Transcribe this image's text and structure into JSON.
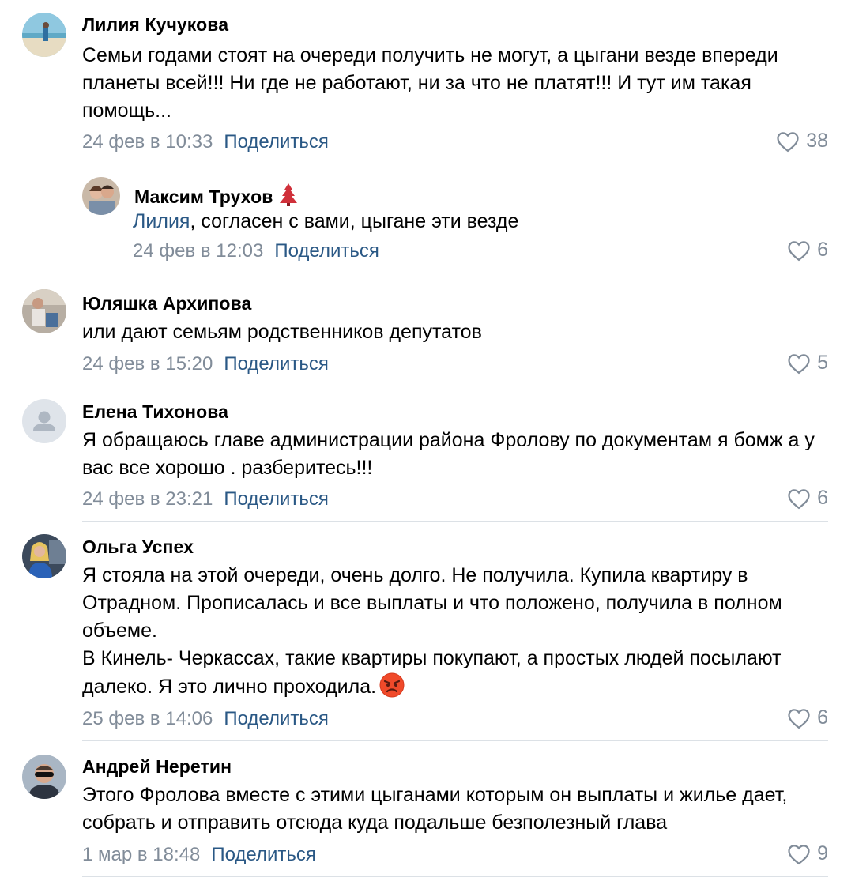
{
  "comments": [
    {
      "author": "Лилия Кучукова",
      "lines": [
        "Семьи годами стоят на очереди получить не могут, а цыгани везде впереди планеты всей!!! Ни где не работают, ни за что не платят!!! И тут им такая помощь..."
      ],
      "date": "24 фев в 10:33",
      "share": "Поделиться",
      "likes": "38"
    },
    {
      "author": "Максим Трухов",
      "mention": "Лилия",
      "text": ", согласен с вами, цыгане эти везде",
      "date": "24 фев в 12:03",
      "share": "Поделиться",
      "likes": "6"
    },
    {
      "author": "Юляшка Архипова",
      "lines": [
        "или дают семьям родственников депутатов"
      ],
      "date": "24 фев в 15:20",
      "share": "Поделиться",
      "likes": "5"
    },
    {
      "author": "Елена Тихонова",
      "lines": [
        "Я обращаюсь главе администрации района Фролову по документам я бомж а у вас все хорошо . разберитесь!!!"
      ],
      "date": "24 фев в 23:21",
      "share": "Поделиться",
      "likes": "6"
    },
    {
      "author": "Ольга Успех",
      "lines": [
        "Я стояла на этой очереди, очень долго. Не получила. Купила квартиру в Отрадном. Прописалась и все выплаты и что положено, получила в полном объеме.",
        "В Кинель- Черкассах, такие квартиры покупают, а простых людей посылают далеко. Я это лично проходила."
      ],
      "date": "25 фев в 14:06",
      "share": "Поделиться",
      "likes": "6"
    },
    {
      "author": "Андрей Неретин",
      "lines": [
        "Этого Фролова вместе с этими цыганами которым он выплаты и жилье дает, собрать и отправить отсюда куда подальше безполезный глава"
      ],
      "date": "1 мар в 18:48",
      "share": "Поделиться",
      "likes": "9"
    }
  ],
  "icons": {
    "like": "heart-outline-icon",
    "emoji": "angry-face-emoji",
    "badge": "christmas-tree-icon"
  },
  "colors": {
    "link": "#2a5885",
    "meta": "#818c99",
    "divider": "#dce1e6"
  }
}
